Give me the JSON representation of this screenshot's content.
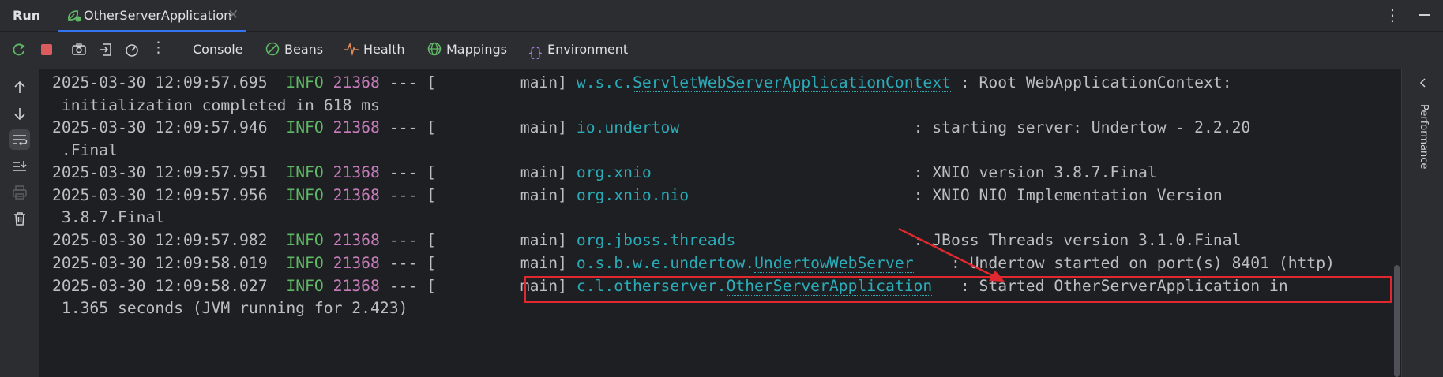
{
  "tabbar": {
    "run_label": "Run",
    "tab_title": "OtherServerApplication",
    "tab_icon": "spring-boot-run-icon",
    "close_glyph": "✕",
    "more_glyph": "⋮"
  },
  "toolbar": {
    "more_glyph": "⋮",
    "tabs": [
      {
        "label": "Console",
        "icon": ""
      },
      {
        "label": "Beans",
        "icon": "beans-icon"
      },
      {
        "label": "Health",
        "icon": "health-icon"
      },
      {
        "label": "Mappings",
        "icon": "mappings-icon"
      },
      {
        "label": "Environment",
        "icon": "environment-icon"
      }
    ]
  },
  "right_panel": {
    "label": "Performance"
  },
  "colors": {
    "info": "#5fb865",
    "pid": "#c77dbb",
    "logger": "#2aacb8",
    "highlight": "#e0282e",
    "background": "#1e1f22"
  },
  "console": {
    "lines": [
      {
        "ts": "2025-03-30 12:09:57.695",
        "level": "INFO",
        "pid": "21368",
        "sep": "---",
        "bracket": "[",
        "thread": "main]",
        "logger_pre": "w.s.c.",
        "logger_link": "ServletWebServerApplicationContext",
        "colon": ":",
        "msg": "Root WebApplicationContext:"
      },
      {
        "cont": "initialization completed in 618 ms"
      },
      {
        "ts": "2025-03-30 12:09:57.946",
        "level": "INFO",
        "pid": "21368",
        "sep": "---",
        "bracket": "[",
        "thread": "main]",
        "logger_pre": "io.undertow",
        "logger_link": "",
        "colon": ":",
        "msg": "starting server: Undertow - 2.2.20"
      },
      {
        "cont": ".Final"
      },
      {
        "ts": "2025-03-30 12:09:57.951",
        "level": "INFO",
        "pid": "21368",
        "sep": "---",
        "bracket": "[",
        "thread": "main]",
        "logger_pre": "org.xnio",
        "logger_link": "",
        "colon": ":",
        "msg": "XNIO version 3.8.7.Final"
      },
      {
        "ts": "2025-03-30 12:09:57.956",
        "level": "INFO",
        "pid": "21368",
        "sep": "---",
        "bracket": "[",
        "thread": "main]",
        "logger_pre": "org.xnio.nio",
        "logger_link": "",
        "colon": ":",
        "msg": "XNIO NIO Implementation Version"
      },
      {
        "cont": "3.8.7.Final"
      },
      {
        "ts": "2025-03-30 12:09:57.982",
        "level": "INFO",
        "pid": "21368",
        "sep": "---",
        "bracket": "[",
        "thread": "main]",
        "logger_pre": "org.jboss.threads",
        "logger_link": "",
        "colon": ":",
        "msg": "JBoss Threads version 3.1.0.Final"
      },
      {
        "ts": "2025-03-30 12:09:58.019",
        "level": "INFO",
        "pid": "21368",
        "sep": "---",
        "bracket": "[",
        "thread": "main]",
        "logger_pre": "o.s.b.w.e.undertow.",
        "logger_link": "UndertowWebServer",
        "colon": ":",
        "msg": "Undertow started on port(s) 8401 (http)"
      },
      {
        "ts": "2025-03-30 12:09:58.027",
        "level": "INFO",
        "pid": "21368",
        "sep": "---",
        "bracket": "[",
        "thread": "main]",
        "logger_pre": "c.l.otherserver.",
        "logger_link": "OtherServerApplication",
        "colon": ":",
        "msg": "Started OtherServerApplication in"
      },
      {
        "cont": "1.365 seconds (JVM running for 2.423)"
      }
    ]
  }
}
